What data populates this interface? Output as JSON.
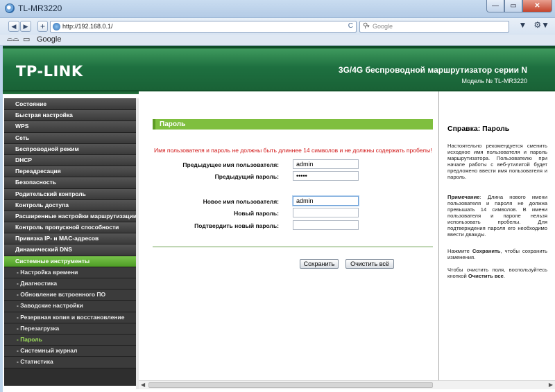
{
  "window": {
    "title": "TL-MR3220",
    "min_label": "—",
    "max_label": "▭",
    "close_label": "✕"
  },
  "browser": {
    "back_label": "◀",
    "forward_label": "▶",
    "add_label": "+",
    "url": "http://192.168.0.1/",
    "reload_label": "C",
    "search_placeholder": "Google",
    "page_menu_label": "▼",
    "tools_menu_label": "⚙▼"
  },
  "bookmarks": {
    "google_label": "Google"
  },
  "header": {
    "logo": "TP-LINK",
    "product_title": "3G/4G беспроводной маршрутизатор серии N",
    "model": "Модель № TL-MR3220"
  },
  "sidebar": {
    "items": [
      {
        "label": "Состояние",
        "type": "main"
      },
      {
        "label": "Быстрая настройка",
        "type": "main"
      },
      {
        "label": "WPS",
        "type": "main"
      },
      {
        "label": "Сеть",
        "type": "main"
      },
      {
        "label": "Беспроводной режим",
        "type": "main"
      },
      {
        "label": "DHCP",
        "type": "main"
      },
      {
        "label": "Переадресация",
        "type": "main"
      },
      {
        "label": "Безопасность",
        "type": "main"
      },
      {
        "label": "Родительский контроль",
        "type": "main"
      },
      {
        "label": "Контроль доступа",
        "type": "main"
      },
      {
        "label": "Расширенные настройки маршрутизации",
        "type": "main"
      },
      {
        "label": "Контроль пропускной способности",
        "type": "main"
      },
      {
        "label": "Привязка IP- и MAC-адресов",
        "type": "main"
      },
      {
        "label": "Динамический DNS",
        "type": "main"
      },
      {
        "label": "Системные инструменты",
        "type": "active"
      },
      {
        "label": "- Настройка времени",
        "type": "sub"
      },
      {
        "label": "- Диагностика",
        "type": "sub"
      },
      {
        "label": "- Обновление встроенного ПО",
        "type": "sub"
      },
      {
        "label": "- Заводские настройки",
        "type": "sub"
      },
      {
        "label": "- Резервная копия и восстановление",
        "type": "sub"
      },
      {
        "label": "- Перезагрузка",
        "type": "sub"
      },
      {
        "label": "- Пароль",
        "type": "sub-active"
      },
      {
        "label": "- Системный журнал",
        "type": "sub"
      },
      {
        "label": "- Статистика",
        "type": "sub"
      }
    ]
  },
  "form": {
    "section_title": "Пароль",
    "warning": "Имя пользователя и пароль не должны быть длиннее 14 символов и не должны содержать пробелы!",
    "old_user_label": "Предыдущее имя пользователя:",
    "old_user_value": "admin",
    "old_pass_label": "Предыдущий пароль:",
    "old_pass_value": "•••••",
    "new_user_label": "Новое имя пользователя:",
    "new_user_value": "admin",
    "new_pass_label": "Новый пароль:",
    "new_pass_value": "",
    "confirm_pass_label": "Подтвердить новый пароль:",
    "confirm_pass_value": "",
    "save_label": "Сохранить",
    "clear_label": "Очистить всё"
  },
  "help": {
    "title": "Справка: Пароль",
    "p1": "Настоятельно рекомендуется сменить исходное имя пользователя и пароль маршрутизатора. Пользователю при начале работы с веб-утилитой будет предложено ввести имя пользователя и пароль.",
    "note_label": "Примечание",
    "p2": ": Длина нового имени пользователя и пароля не должна превышать 14 символов. В имени пользователя и пароле нельзя использовать пробелы. Для подтверждения пароля его необходимо ввести дважды.",
    "p3_a": "Нажмите ",
    "p3_b": "Сохранить",
    "p3_c": ", чтобы сохранить изменения.",
    "p4_a": "Чтобы очистить поля, воспользуйтесь кнопкой ",
    "p4_b": "Очистить все",
    "p4_c": "."
  },
  "colors": {
    "brand_green": "#1e7040",
    "accent_green": "#7fbf3f",
    "warning_red": "#d01515"
  }
}
